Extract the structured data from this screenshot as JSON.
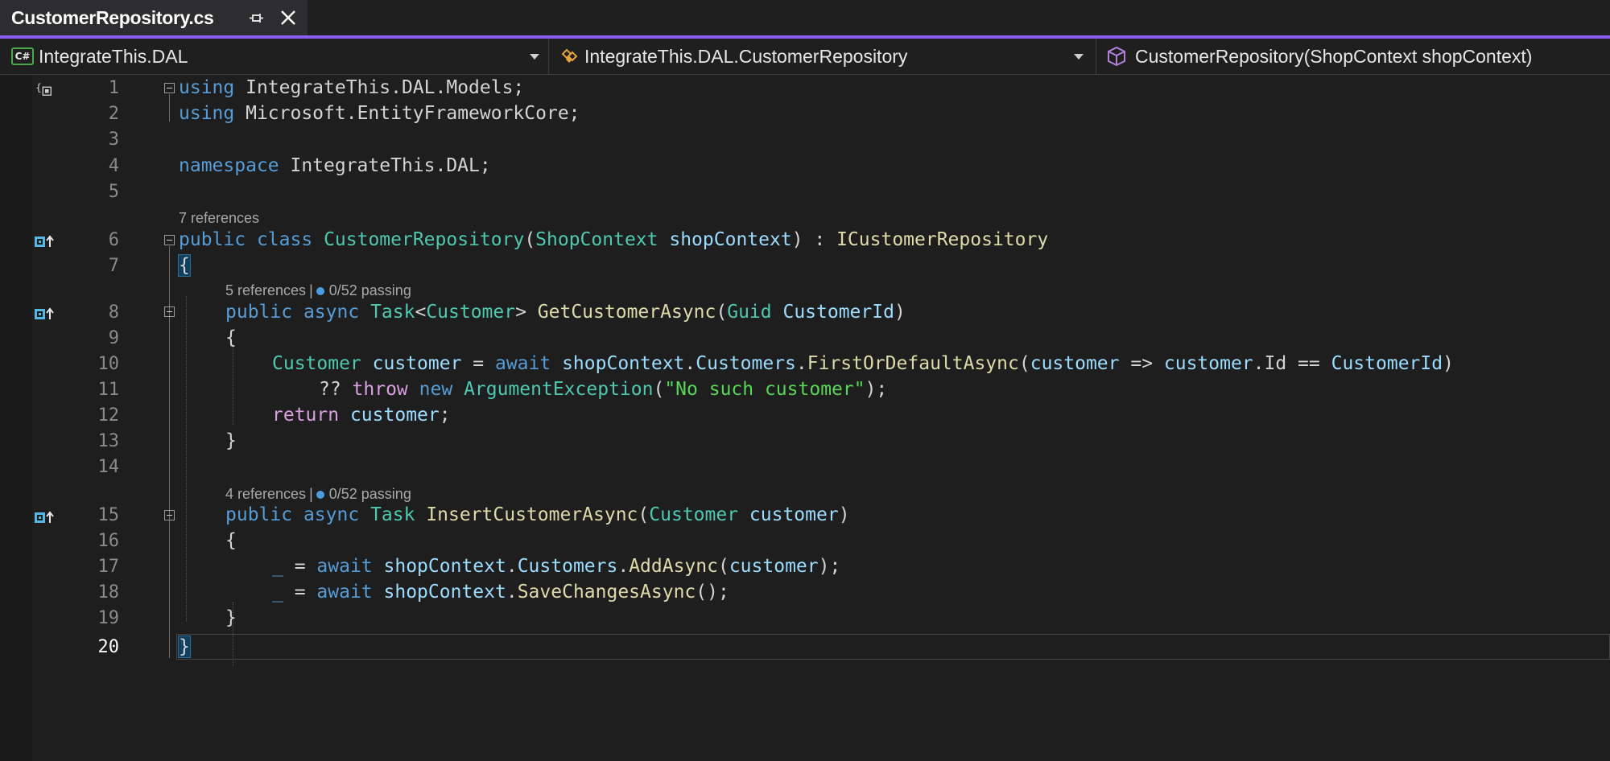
{
  "tab": {
    "title": "CustomerRepository.cs",
    "pin_icon": "pin-icon",
    "close_icon": "close-icon"
  },
  "nav": {
    "project": "IntegrateThis.DAL",
    "type": "IntegrateThis.DAL.CustomerRepository",
    "member": "CustomerRepository(ShopContext shopContext)",
    "project_icon": "csharp-project-icon",
    "member_icon": "cube-icon"
  },
  "lens": {
    "class_refs": "7 references",
    "get_refs": "5 references",
    "get_tests": "0/52 passing",
    "insert_refs": "4 references",
    "insert_tests": "0/52 passing",
    "separator": "|"
  },
  "code": {
    "l1": [
      "using",
      " IntegrateThis.DAL.Models;"
    ],
    "l2": [
      "using",
      " Microsoft.EntityFrameworkCore;"
    ],
    "l4": [
      "namespace",
      " IntegrateThis.DAL;"
    ],
    "l6": [
      "public",
      " ",
      "class",
      " ",
      "CustomerRepository",
      "(",
      "ShopContext",
      " ",
      "shopContext",
      ") : ",
      "ICustomerRepository"
    ],
    "l7": [
      "{"
    ],
    "l8": [
      "public",
      " ",
      "async",
      " ",
      "Task",
      "<",
      "Customer",
      "> ",
      "GetCustomerAsync",
      "(",
      "Guid",
      " ",
      "CustomerId",
      ")"
    ],
    "l9": [
      "{"
    ],
    "l10": [
      "Customer",
      " ",
      "customer",
      " = ",
      "await",
      " ",
      "shopContext",
      ".",
      "Customers",
      ".",
      "FirstOrDefaultAsync",
      "(",
      "customer",
      " => ",
      "customer",
      ".Id == ",
      "CustomerId",
      ")"
    ],
    "l11": [
      "?? ",
      "throw",
      " ",
      "new",
      " ",
      "ArgumentException",
      "(",
      "\"No such customer\"",
      ");"
    ],
    "l12": [
      "return",
      " ",
      "customer",
      ";"
    ],
    "l13": [
      "}"
    ],
    "l15": [
      "public",
      " ",
      "async",
      " ",
      "Task",
      " ",
      "InsertCustomerAsync",
      "(",
      "Customer",
      " ",
      "customer",
      ")"
    ],
    "l16": [
      "{"
    ],
    "l17": [
      "_",
      " = ",
      "await",
      " ",
      "shopContext",
      ".",
      "Customers",
      ".",
      "AddAsync",
      "(",
      "customer",
      ");"
    ],
    "l18": [
      "_",
      " = ",
      "await",
      " ",
      "shopContext",
      ".",
      "SaveChangesAsync",
      "();"
    ],
    "l19": [
      "}"
    ],
    "l20": [
      "}"
    ]
  },
  "line_numbers": [
    "1",
    "2",
    "3",
    "4",
    "5",
    "6",
    "7",
    "8",
    "9",
    "10",
    "11",
    "12",
    "13",
    "14",
    "15",
    "16",
    "17",
    "18",
    "19",
    "20"
  ],
  "colors": {
    "accent": "#8a5ef0",
    "keyword": "#569cd6",
    "control": "#d8a0df",
    "type": "#4ec9b0",
    "method": "#dcdcaa",
    "param": "#9cdcfe",
    "string": "#57d657"
  }
}
